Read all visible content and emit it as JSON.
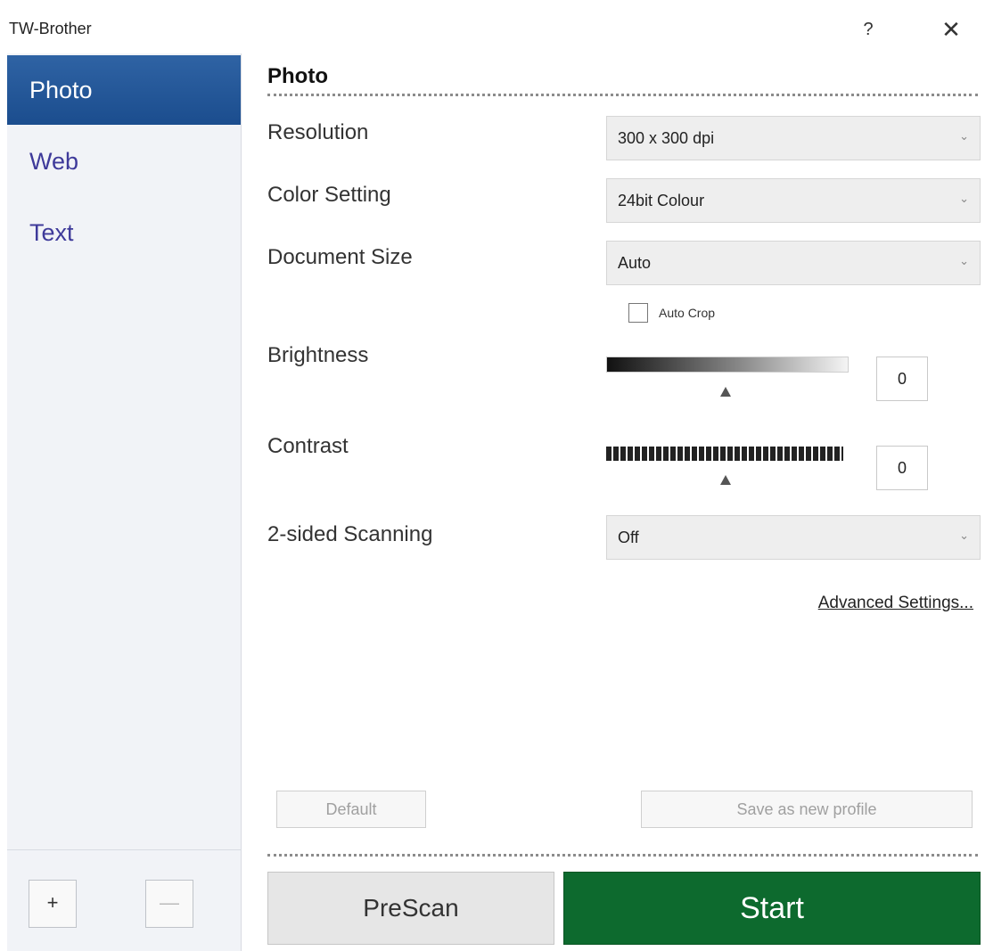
{
  "window": {
    "title": "TW-Brother",
    "help_label": "?",
    "close_label": "✕"
  },
  "sidebar": {
    "items": [
      {
        "label": "Photo",
        "active": true
      },
      {
        "label": "Web",
        "active": false
      },
      {
        "label": "Text",
        "active": false
      }
    ],
    "add_label": "+",
    "remove_label": "—"
  },
  "main": {
    "section_title": "Photo",
    "resolution": {
      "label": "Resolution",
      "value": "300 x 300 dpi"
    },
    "color_setting": {
      "label": "Color Setting",
      "value": "24bit Colour"
    },
    "document_size": {
      "label": "Document Size",
      "value": "Auto"
    },
    "auto_crop": {
      "label": "Auto Crop",
      "checked": false
    },
    "brightness": {
      "label": "Brightness",
      "value": "0"
    },
    "contrast": {
      "label": "Contrast",
      "value": "0"
    },
    "two_sided": {
      "label": "2-sided Scanning",
      "value": "Off"
    },
    "advanced_settings": "Advanced Settings...",
    "default_label": "Default",
    "save_profile_label": "Save as new profile",
    "prescan_label": "PreScan",
    "start_label": "Start",
    "dropdown_arrow": "⌄"
  },
  "colors": {
    "sidebar_active": "#1f5394",
    "sidebar_text": "#3e3a9a",
    "start_button": "#0d6a2e"
  }
}
